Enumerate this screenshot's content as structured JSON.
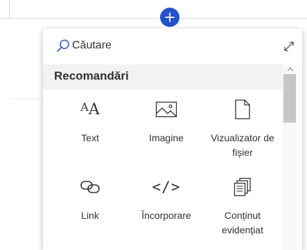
{
  "search": {
    "placeholder": "Căutare"
  },
  "section": {
    "title": "Recomandări"
  },
  "tiles": [
    {
      "label": "Text",
      "icon": "text-icon"
    },
    {
      "label": "Imagine",
      "icon": "image-icon"
    },
    {
      "label": "Vizualizator de fișier",
      "icon": "file-icon"
    },
    {
      "label": "Link",
      "icon": "link-icon"
    },
    {
      "label": "Încorporare",
      "icon": "embed-code-icon"
    },
    {
      "label": "Conținut evidențiat",
      "icon": "highlighted-content-icon"
    }
  ],
  "icons": {
    "text_glyph_small": "A",
    "text_glyph_large": "A",
    "embed_glyph": "</>"
  },
  "colors": {
    "accent": "#2552c8",
    "section_bg": "#f3f2f1",
    "scroll_thumb": "#c8c6c4",
    "text": "#323130"
  }
}
